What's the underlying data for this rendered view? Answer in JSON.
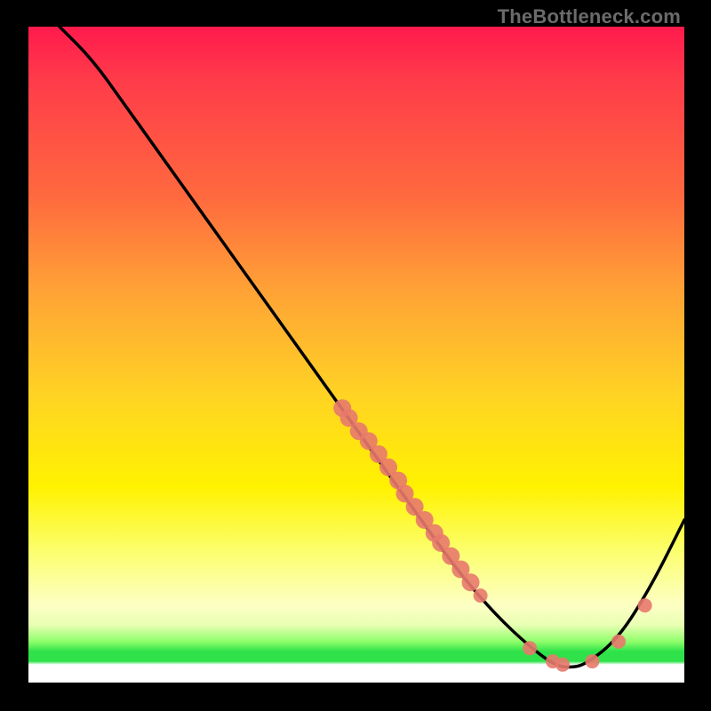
{
  "watermark": "TheBottleneck.com",
  "chart_data": {
    "type": "line",
    "title": "",
    "xlabel": "",
    "ylabel": "",
    "xlim": [
      0,
      100
    ],
    "ylim": [
      0,
      100
    ],
    "grid": false,
    "legend": false,
    "series": [
      {
        "name": "bottleneck-curve",
        "color": "#000000",
        "x": [
          5,
          10,
          15,
          20,
          25,
          30,
          35,
          40,
          45,
          50,
          55,
          60,
          65,
          70,
          75,
          80,
          82.5,
          85,
          90,
          95,
          100
        ],
        "y": [
          100,
          95,
          88,
          81,
          74,
          67,
          60,
          53,
          46,
          39,
          32,
          25,
          18,
          12,
          7,
          3,
          2.5,
          3,
          7,
          15,
          25
        ]
      }
    ],
    "clusters": [
      {
        "comment": "upper cluster of salmon dots along descending line",
        "color": "#e8796d",
        "radius": 10,
        "points": [
          {
            "x": 48,
            "y": 42.0
          },
          {
            "x": 49,
            "y": 40.5
          },
          {
            "x": 50.5,
            "y": 38.5
          },
          {
            "x": 52,
            "y": 37.0
          },
          {
            "x": 53.5,
            "y": 35.0
          },
          {
            "x": 55,
            "y": 33.0
          },
          {
            "x": 56.5,
            "y": 31.0
          }
        ]
      },
      {
        "comment": "lower cluster of salmon dots along descending line",
        "color": "#e8796d",
        "radius": 10,
        "points": [
          {
            "x": 57.5,
            "y": 29.0
          },
          {
            "x": 59,
            "y": 27.0
          },
          {
            "x": 60.5,
            "y": 25.0
          },
          {
            "x": 62,
            "y": 23.0
          },
          {
            "x": 63,
            "y": 21.5
          },
          {
            "x": 64.5,
            "y": 19.5
          },
          {
            "x": 66,
            "y": 17.5
          },
          {
            "x": 67.5,
            "y": 15.5
          }
        ]
      },
      {
        "comment": "small scattered dots near the valley and on rising side",
        "color": "#e8796d",
        "radius": 8,
        "points": [
          {
            "x": 69,
            "y": 13.5
          },
          {
            "x": 76.5,
            "y": 5.5
          },
          {
            "x": 80,
            "y": 3.5
          },
          {
            "x": 81.5,
            "y": 3.0
          },
          {
            "x": 86,
            "y": 3.5
          },
          {
            "x": 90,
            "y": 6.5
          },
          {
            "x": 94,
            "y": 12.0
          }
        ]
      }
    ]
  }
}
